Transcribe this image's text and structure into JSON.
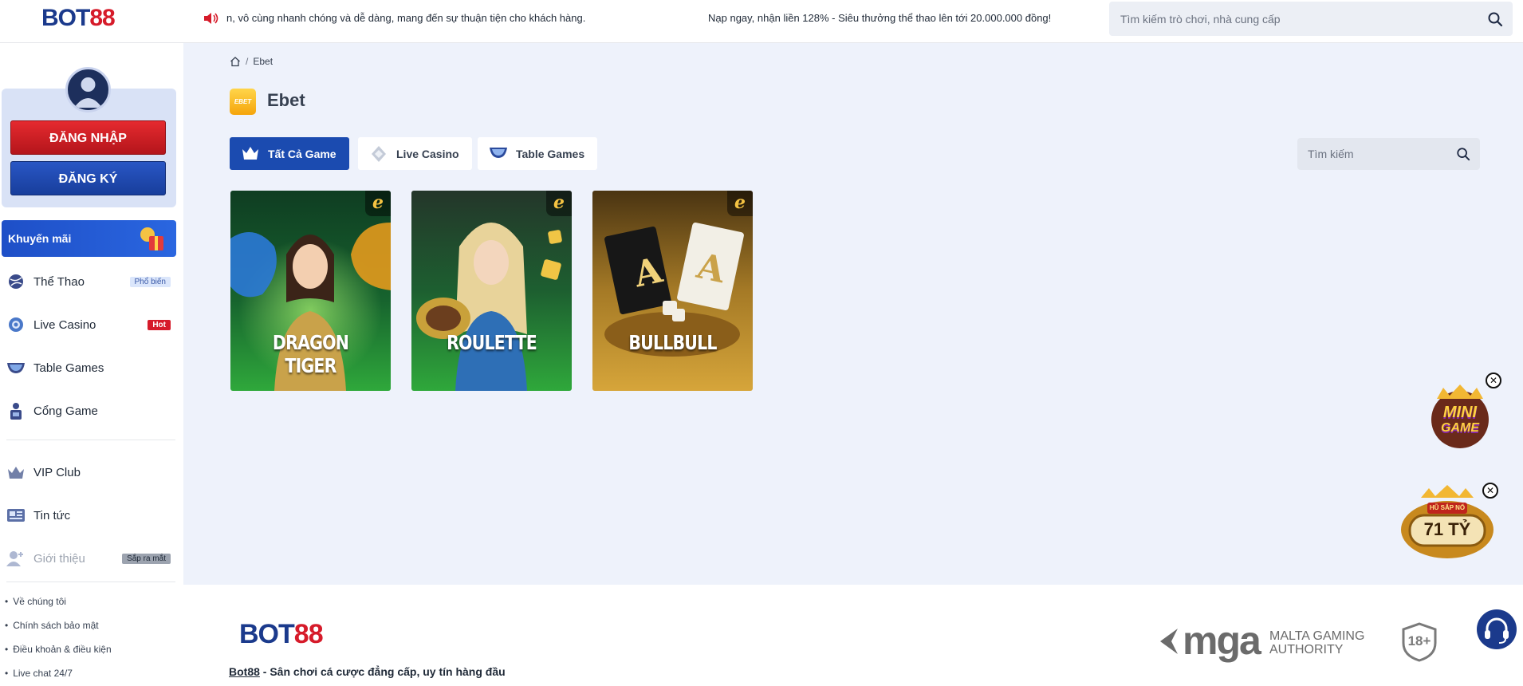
{
  "header": {
    "logo_part1": "BOT",
    "logo_part2": "88",
    "marquee_1": "n, vô cùng nhanh chóng và dễ dàng, mang đến sự thuận tiện cho khách hàng.",
    "marquee_2": "Nạp ngay, nhận liền 128% - Siêu thưởng thể thao lên tới 20.000.000 đồng!",
    "search_placeholder": "Tìm kiếm trò chơi, nhà cung cấp"
  },
  "sidebar": {
    "login_label": "ĐĂNG NHẬP",
    "register_label": "ĐĂNG KÝ",
    "promo_label": "Khuyến mãi",
    "items": [
      {
        "label": "Thể Thao",
        "badge": "Phổ biến"
      },
      {
        "label": "Live Casino",
        "badge": "Hot"
      },
      {
        "label": "Table Games",
        "badge": ""
      },
      {
        "label": "Cổng Game",
        "badge": ""
      },
      {
        "label": "VIP Club",
        "badge": ""
      },
      {
        "label": "Tin tức",
        "badge": ""
      },
      {
        "label": "Giới thiệu",
        "badge": "Sắp ra mắt"
      }
    ],
    "footer_links": [
      "Về chúng tôi",
      "Chính sách bảo mật",
      "Điều khoản & điều kiện",
      "Live chat 24/7"
    ]
  },
  "main": {
    "breadcrumb_current": "Ebet",
    "provider_logo_text": "EBET",
    "title": "Ebet",
    "tabs": [
      {
        "label": "Tất Cả Game",
        "active": true
      },
      {
        "label": "Live Casino",
        "active": false
      },
      {
        "label": "Table Games",
        "active": false
      }
    ],
    "search_placeholder": "Tìm kiếm",
    "games": [
      {
        "title": "DRAGON TIGER",
        "provider_mark": "e"
      },
      {
        "title": "ROULETTE",
        "provider_mark": "e"
      },
      {
        "title": "BULLBULL",
        "provider_mark": "e"
      }
    ]
  },
  "footer": {
    "logo_part1": "BOT",
    "logo_part2": "88",
    "brand": "Bot88",
    "tagline": " - Sân chơi cá cược đẳng cấp, uy tín hàng đầu",
    "mga_text": "mga",
    "mga_sub": "MALTA GAMING AUTHORITY",
    "age_label": "18+"
  },
  "widgets": {
    "jackpot_label": "HŨ SẮP NỔ",
    "jackpot_value": "71 TỶ",
    "mini_game_label_1": "MINI",
    "mini_game_label_2": "GAME"
  },
  "colors": {
    "brand_blue": "#1b3a8c",
    "brand_red": "#d61b2a",
    "tab_active": "#1b4bb0",
    "page_bg": "#eef2fb"
  }
}
